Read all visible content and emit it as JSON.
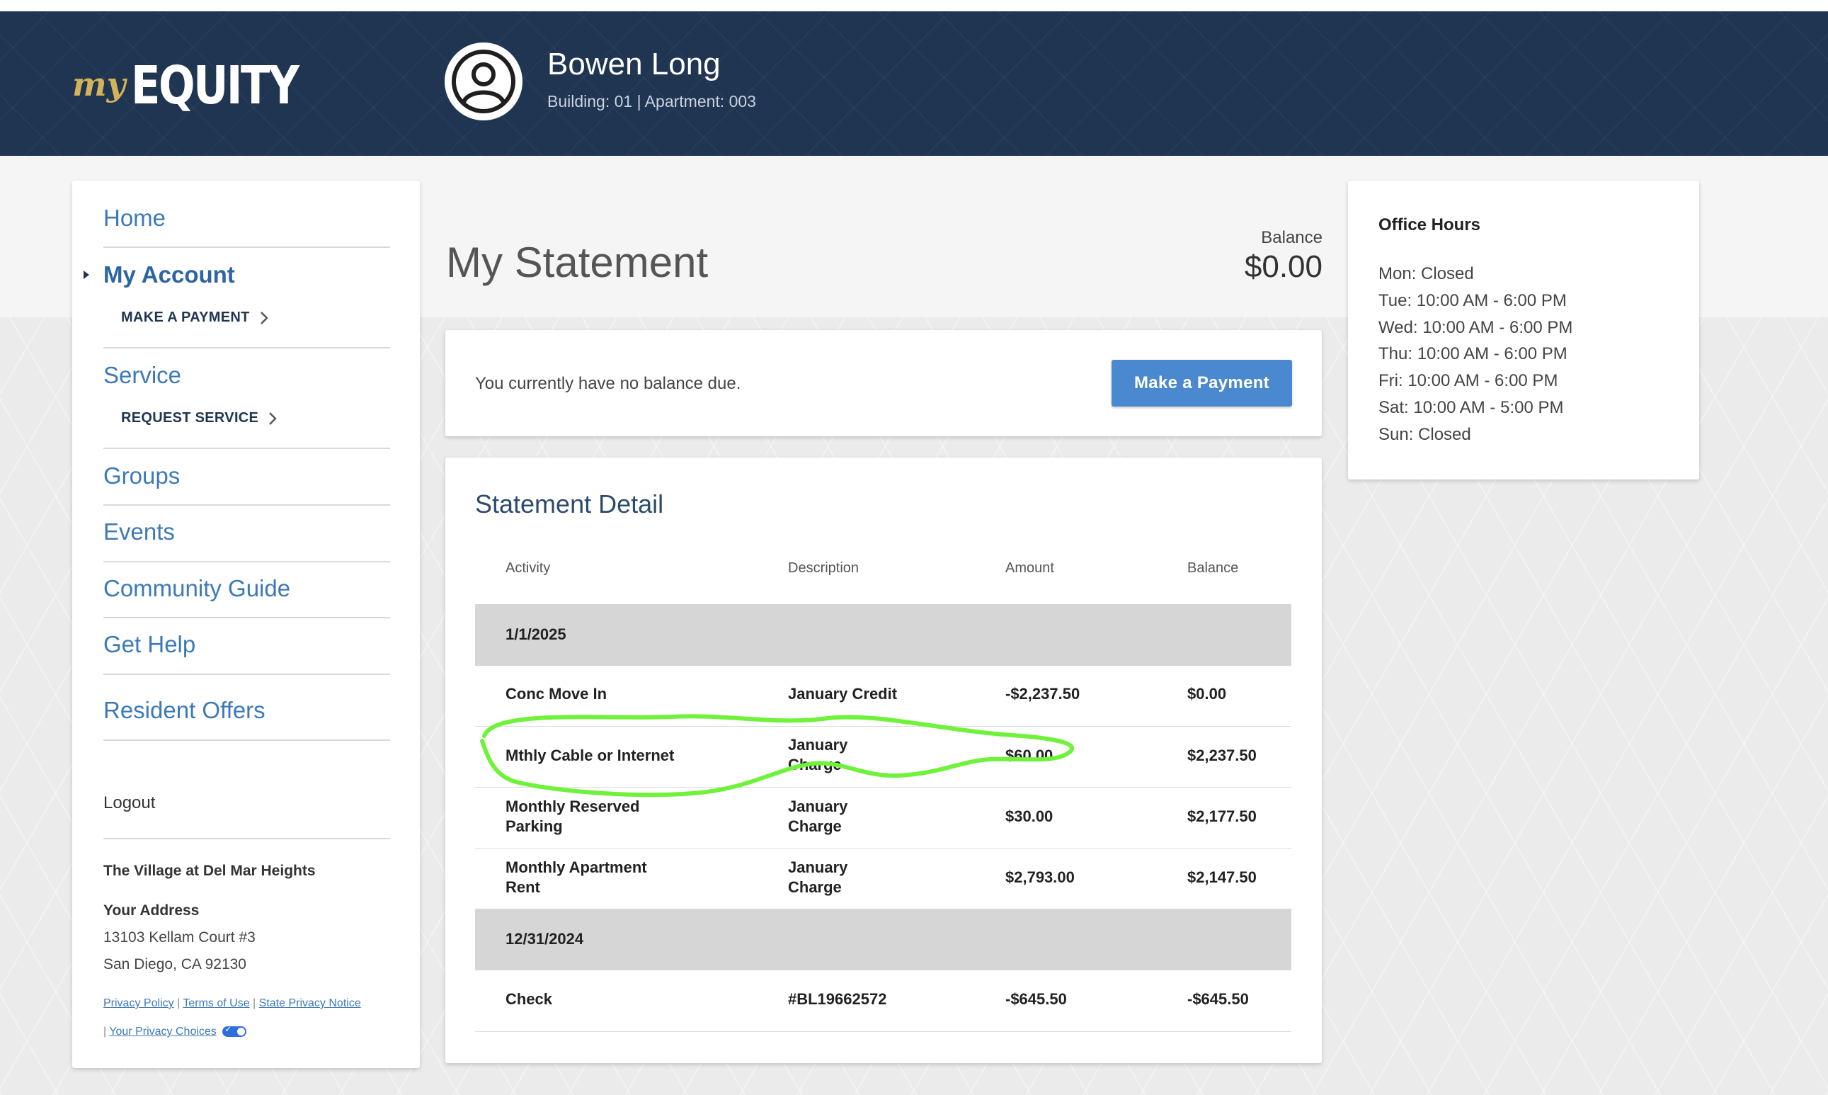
{
  "header": {
    "logo_my": "my",
    "logo_equity": "EQUITY",
    "user_name": "Bowen Long",
    "user_meta": "Building: 01 | Apartment: 003"
  },
  "sidebar": {
    "items": [
      {
        "label": "Home"
      },
      {
        "label": "My Account",
        "sub": "MAKE A PAYMENT"
      },
      {
        "label": "Service",
        "sub": "REQUEST SERVICE"
      },
      {
        "label": "Groups"
      },
      {
        "label": "Events"
      },
      {
        "label": "Community Guide"
      },
      {
        "label": "Get Help"
      },
      {
        "label": "Resident Offers"
      }
    ],
    "logout": "Logout",
    "property_name": "The Village at Del Mar Heights",
    "address_label": "Your Address",
    "address_line1": "13103 Kellam Court #3",
    "address_line2": "San Diego, CA 92130",
    "links": {
      "privacy_policy": "Privacy Policy",
      "terms": "Terms of Use",
      "state_privacy": "State Privacy Notice",
      "privacy_choices": "Your Privacy Choices"
    }
  },
  "main": {
    "title": "My Statement",
    "balance_label": "Balance",
    "balance_value": "$0.00",
    "notice": "You currently have no balance due.",
    "pay_button": "Make a Payment",
    "detail_title": "Statement Detail",
    "columns": [
      "Activity",
      "Description",
      "Amount",
      "Balance"
    ],
    "groups": [
      {
        "date": "1/1/2025",
        "rows": [
          {
            "activity": "Conc Move In",
            "description": "January Credit",
            "amount": "-$2,237.50",
            "balance": "$0.00"
          },
          {
            "activity": "Mthly Cable or Internet",
            "description": "January Charge",
            "amount": "$60.00",
            "balance": "$2,237.50"
          },
          {
            "activity": "Monthly Reserved Parking",
            "description": "January Charge",
            "amount": "$30.00",
            "balance": "$2,177.50"
          },
          {
            "activity": "Monthly Apartment Rent",
            "description": "January Charge",
            "amount": "$2,793.00",
            "balance": "$2,147.50"
          }
        ]
      },
      {
        "date": "12/31/2024",
        "rows": [
          {
            "activity": "Check",
            "description": "#BL19662572",
            "amount": "-$645.50",
            "balance": "-$645.50"
          }
        ]
      }
    ]
  },
  "office_hours": {
    "title": "Office Hours",
    "lines": [
      "Mon: Closed",
      "Tue: 10:00 AM - 6:00 PM",
      "Wed: 10:00 AM - 6:00 PM",
      "Thu: 10:00 AM - 6:00 PM",
      "Fri: 10:00 AM - 6:00 PM",
      "Sat: 10:00 AM - 5:00 PM",
      "Sun: Closed"
    ]
  },
  "colors": {
    "header_bg": "#1f3552",
    "accent": "#4a88cf",
    "link": "#3d79b8",
    "gold": "#d4b25a",
    "highlight_marker": "#6ff23a"
  }
}
